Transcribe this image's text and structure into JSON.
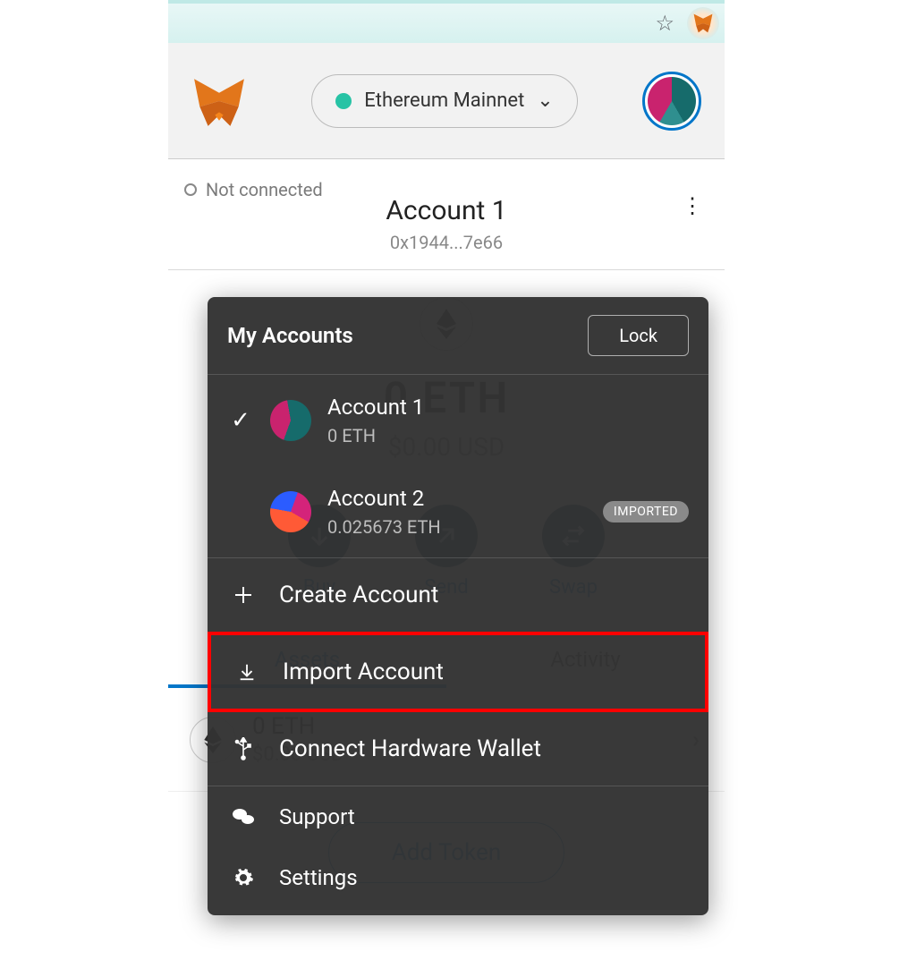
{
  "browser": {
    "extension_name": "MetaMask"
  },
  "header": {
    "network": "Ethereum Mainnet",
    "network_status_color": "#27c3a5"
  },
  "main": {
    "connection_status": "Not connected",
    "account_name": "Account 1",
    "address_short": "0x1944...7e66",
    "balance_main": "0 ETH",
    "balance_usd": "$0.00 USD",
    "actions": {
      "buy": "Buy",
      "send": "Send",
      "swap": "Swap"
    },
    "tabs": {
      "assets": "Assets",
      "activity": "Activity"
    },
    "token": {
      "balance": "0 ETH",
      "usd": "$0.00 USD"
    },
    "add_token": "Add Token"
  },
  "menu": {
    "title": "My Accounts",
    "lock": "Lock",
    "accounts": [
      {
        "name": "Account 1",
        "balance": "0 ETH",
        "selected": true,
        "imported": false
      },
      {
        "name": "Account 2",
        "balance": "0.025673 ETH",
        "selected": false,
        "imported": true
      }
    ],
    "imported_badge": "IMPORTED",
    "create": "Create Account",
    "import": "Import Account",
    "connect_hw": "Connect Hardware Wallet",
    "support": "Support",
    "settings": "Settings"
  }
}
